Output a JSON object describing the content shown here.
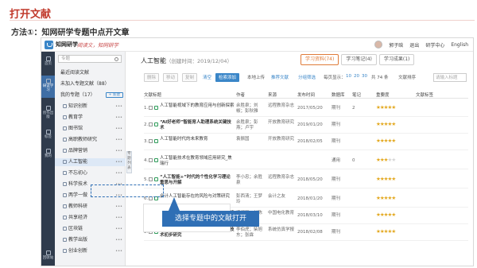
{
  "slide": {
    "title": "打开文献",
    "subtitle": "方法①：知网研学专题中点开文章"
  },
  "app": {
    "brand": "知网研学",
    "slogan": "阅读文，知网研学",
    "user": "郭子晗",
    "topbar_links": [
      "退出",
      "研学中心",
      "English"
    ]
  },
  "rail": [
    {
      "label": "首页",
      "icon": "home-icon"
    },
    {
      "label": "研读学习",
      "icon": "book-icon",
      "active": true
    },
    {
      "label": "创作出版",
      "icon": "edit-icon"
    },
    {
      "label": "标签",
      "icon": "tag-icon"
    },
    {
      "label": "我的",
      "icon": "user-icon"
    },
    {
      "label": "回收站",
      "icon": "trash-icon"
    }
  ],
  "tree": {
    "search_placeholder": "专题",
    "items": [
      {
        "label": "最近阅读文献",
        "type": "plain"
      },
      {
        "label": "未加入专题文献（88）",
        "type": "plain"
      },
      {
        "label": "我的专题（17）",
        "type": "plain",
        "new_button": "+ 新建"
      },
      {
        "label": "知识创新",
        "type": "folder"
      },
      {
        "label": "教育学",
        "type": "folder"
      },
      {
        "label": "图书馆",
        "type": "folder"
      },
      {
        "label": "高职教师研究",
        "type": "folder"
      },
      {
        "label": "品牌营销",
        "type": "folder"
      },
      {
        "label": "人工智能",
        "type": "folder",
        "selected": true
      },
      {
        "label": "不忘初心",
        "type": "folder"
      },
      {
        "label": "科学技术",
        "type": "folder"
      },
      {
        "label": "两学一做",
        "type": "folder"
      },
      {
        "label": "教师科研",
        "type": "folder"
      },
      {
        "label": "共享经济",
        "type": "folder"
      },
      {
        "label": "区块链",
        "type": "folder"
      },
      {
        "label": "教学出版",
        "type": "folder"
      },
      {
        "label": "创业创新",
        "type": "folder"
      }
    ],
    "collapse_label": "专题列表"
  },
  "main": {
    "topic": "人工智能",
    "created": "（创建时间：2019/12/04）",
    "tabs": [
      {
        "label": "学习资料",
        "count": "(74)",
        "active": true
      },
      {
        "label": "学习笔记",
        "count": "(4)"
      },
      {
        "label": "学习成果",
        "count": "(1)"
      }
    ],
    "toolbar": {
      "delete": "删除",
      "move": "移动",
      "copy": "复制",
      "clear": "清空",
      "search_add": "检索添加",
      "upload": "本地上传",
      "cite": "推荐文献",
      "filter": "分组筛选",
      "page_size_label": "每页显示：",
      "page_sizes": [
        "10",
        "20",
        "30"
      ],
      "total": "共 74 条",
      "sort": "文献排序",
      "keyword_placeholder": "请输入标题"
    },
    "columns": [
      "文献标题",
      "作者",
      "来源",
      "发布时间",
      "数据库",
      "笔记",
      "重要度",
      "文献标签"
    ],
    "rows": [
      {
        "n": "1.",
        "title": "人工智能视域下的教育应用与创新探索",
        "author": "余胜泉；刘椒；彭秋雅",
        "source": "远程教育杂志",
        "date": "2017/05/20",
        "db": "期刊",
        "notes": "2",
        "stars": 5,
        "bold": false
      },
      {
        "n": "2.",
        "title": "“AI好老师”智能育人助理系统关键技术",
        "author": "余胜泉；彭燕；卢宇",
        "source": "开放教育研究",
        "date": "2019/01/20",
        "db": "期刊",
        "notes": "",
        "stars": 5,
        "bold": true
      },
      {
        "n": "3.",
        "title": "人工智能时代的未来教育",
        "author": "袁振国",
        "source": "开放教育研究",
        "date": "2018/02/05",
        "db": "期刊",
        "notes": "",
        "stars": 5,
        "bold": false
      },
      {
        "n": "4.",
        "title": "人工智能技术在教育领域应用研究_焦瑞行",
        "author": "",
        "source": "",
        "date": "",
        "db": "通用",
        "notes": "0",
        "stars": 3,
        "bold": false
      },
      {
        "n": "5.",
        "title": "“人工智能+”时代的个性化学习理论重思与开解",
        "author": "李小忠；余胜泉",
        "source": "远程教育杂志",
        "date": "2018/05/20",
        "db": "期刊",
        "notes": "",
        "stars": 5,
        "bold": true
      },
      {
        "n": "6.",
        "title": "会计人工智能存在的风险与对策研究",
        "author": "彭西清；王梦玲",
        "source": "会计之友",
        "date": "2018/01/20",
        "db": "期刊",
        "notes": "",
        "stars": 5,
        "bold": false
      },
      {
        "n": "7.",
        "title": "人工智能教育应用的现状分析、典型特征与发展趋势",
        "author": "梁迎丽；刘陈",
        "source": "中国电化教育",
        "date": "2018/03/10",
        "db": "期刊",
        "notes": "",
        "stars": 5,
        "bold": false
      },
      {
        "n": "8.",
        "title": "面向新型人工智能系统的建模与仿真技术初步研究",
        "author": "李伯虎；柴旭东；张霖",
        "source": "系统仿真学报",
        "date": "2018/02/08",
        "db": "期刊",
        "notes": "",
        "stars": 5,
        "bold": true
      }
    ],
    "callout": "选择专题中的文献打开"
  },
  "colors": {
    "title_red": "#c0392b",
    "brand_blue": "#3a86c8",
    "callout_blue": "#2f6fb5",
    "star": "#e3a81f",
    "tab_orange": "#e07b39"
  }
}
